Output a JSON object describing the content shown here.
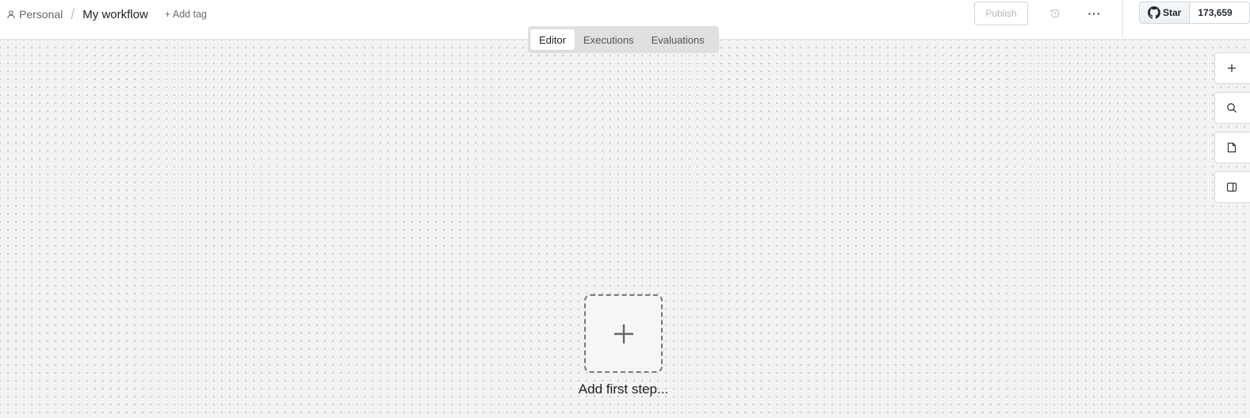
{
  "header": {
    "project_label": "Personal",
    "separator": "/",
    "workflow_title": "My workflow",
    "add_tag_label": "+ Add tag",
    "publish_label": "Publish",
    "more_label": "···",
    "github": {
      "star_label": "Star",
      "star_count": "173,659"
    }
  },
  "tabs": [
    {
      "label": "Editor",
      "active": true
    },
    {
      "label": "Executions",
      "active": false
    },
    {
      "label": "Evaluations",
      "active": false
    }
  ],
  "canvas": {
    "add_first_step_label": "Add first step...",
    "tools": [
      "plus-icon",
      "search-icon",
      "sticky-note-icon",
      "panel-toggle-icon"
    ]
  },
  "colors": {
    "canvas_bg": "#f3f3f3",
    "header_bg": "#ffffff",
    "tab_bar_bg": "#e0e0e0",
    "dashed_border": "#777777"
  }
}
